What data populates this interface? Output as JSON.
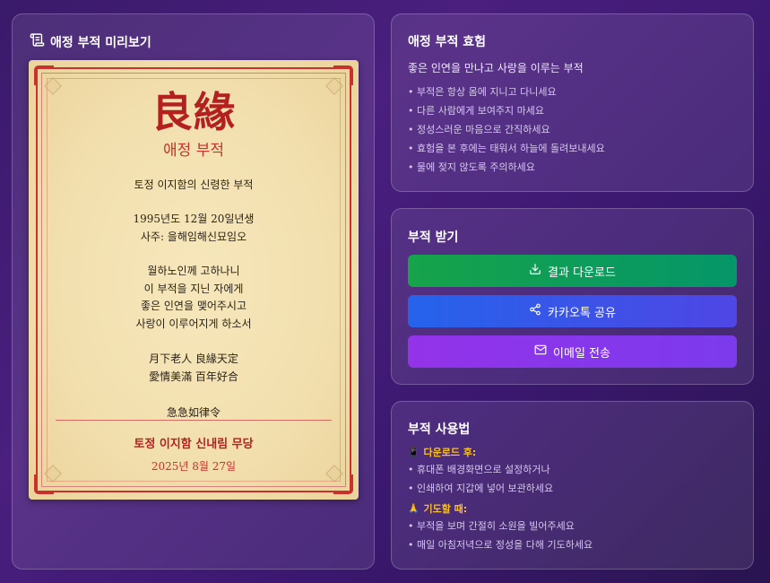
{
  "preview": {
    "title": "애정 부적 미리보기",
    "talisman": {
      "hanja_title": "良緣",
      "subtitle": "애정 부적",
      "intro": "토정 이지함의 신령한 부적",
      "birth": "1995년도 12월 20일년생",
      "saju": "사주: 을해임해신묘임오",
      "prayer": [
        "월하노인께 고하나니",
        "이 부적을 지닌 자에게",
        "좋은 인연을 맺어주시고",
        "사랑이 이루어지게 하소서"
      ],
      "hanja_lines": [
        "月下老人 良緣天定",
        "愛情美滿 百年好合"
      ],
      "closing": "急急如律令",
      "shrine": "토정 이지함 신내림 무당",
      "date": "2025년 8월 27일"
    }
  },
  "effect": {
    "title": "애정 부적 효험",
    "subtitle": "좋은 인연을 만나고 사랑을 이루는 부적",
    "bullets": [
      "• 부적은 항상 몸에 지니고 다니세요",
      "• 다른 사람에게 보여주지 마세요",
      "• 정성스러운 마음으로 간직하세요",
      "• 효험을 본 후에는 태워서 하늘에 돌려보내세요",
      "• 물에 젖지 않도록 주의하세요"
    ]
  },
  "receive": {
    "title": "부적 받기",
    "download_label": "결과 다운로드",
    "kakao_label": "카카오톡 공유",
    "email_label": "이메일 전송"
  },
  "usage": {
    "title": "부적 사용법",
    "after_download": {
      "icon": "📱",
      "heading": "다운로드 후:",
      "items": [
        "• 휴대폰 배경화면으로 설정하거나",
        "• 인쇄하여 지갑에 넣어 보관하세요"
      ]
    },
    "when_praying": {
      "icon": "🙏",
      "heading": "기도할 때:",
      "items": [
        "• 부적을 보며 간절히 소원을 빌어주세요",
        "• 매일 아침저녁으로 정성을 다해 기도하세요"
      ]
    }
  },
  "colors": {
    "accent_red": "#c8322c",
    "download_green": "#16a34a",
    "kakao_blue": "#2563eb",
    "email_purple": "#9333ea",
    "usage_heading_yellow": "#fbbf24"
  }
}
